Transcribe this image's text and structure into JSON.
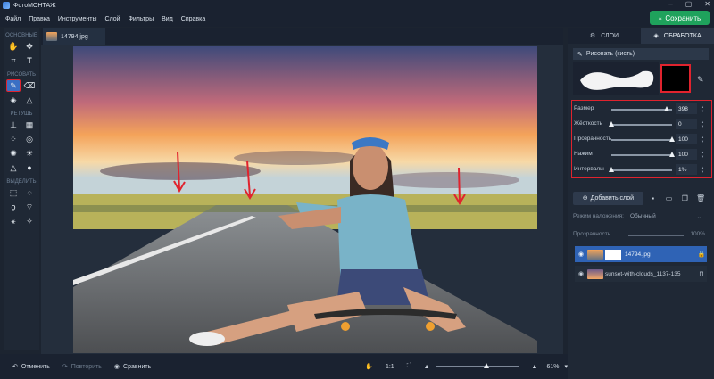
{
  "app": {
    "title": "ФотоМОНТАЖ"
  },
  "window_controls": [
    "–",
    "▢",
    "✕"
  ],
  "menu": [
    "Файл",
    "Правка",
    "Инструменты",
    "Слой",
    "Фильтры",
    "Вид",
    "Справка"
  ],
  "save_label": "Сохранить",
  "toolbox": {
    "sections": [
      "ОСНОВНЫЕ",
      "РИСОВАТЬ",
      "РЕТУШЬ",
      "ВЫДЕЛИТЬ"
    ],
    "active_tool": "brush"
  },
  "document_tab": "14794.jpg",
  "right_panel": {
    "tabs": [
      "СЛОИ",
      "ОБРАБОТКА"
    ],
    "brush_mode_label": "Рисовать (кисть)",
    "brush_color": "#000000",
    "params": [
      {
        "label": "Размер",
        "value": "398",
        "level": 0.92
      },
      {
        "label": "Жёсткость",
        "value": "0",
        "level": 0.0
      },
      {
        "label": "Прозрачность",
        "value": "100",
        "level": 1.0
      },
      {
        "label": "Нажим",
        "value": "100",
        "level": 1.0
      },
      {
        "label": "Интервалы",
        "value": "1%",
        "level": 0.01
      }
    ],
    "add_layer_label": "Добавить слой",
    "blend_mode_label": "Режим наложения:",
    "blend_mode_value": "Обычный",
    "opacity_label": "Прозрачность",
    "opacity_value": "100%",
    "layers": [
      {
        "name": "14794.jpg",
        "selected": true
      },
      {
        "name": "sunset-with-clouds_1137-135",
        "selected": false
      }
    ]
  },
  "bottom_bar": {
    "undo": "Отменить",
    "redo": "Повторить",
    "compare": "Сравнить",
    "actual_size": "1:1",
    "zoom_level": 0.58,
    "zoom": "61%"
  },
  "colors": {
    "accent": "#2f63b5",
    "save": "#1fa25c",
    "highlight": "#e0232e"
  }
}
